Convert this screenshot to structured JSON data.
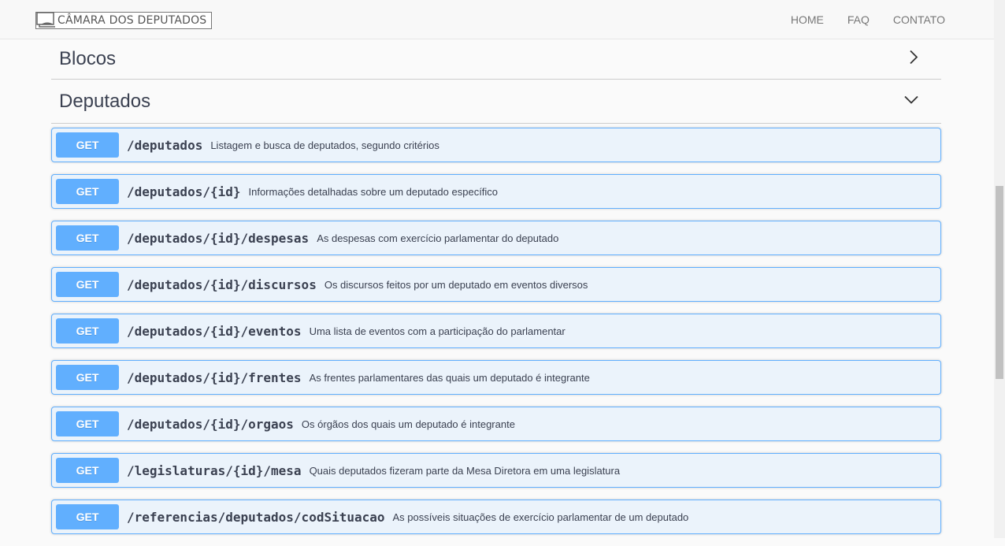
{
  "brand": {
    "text": "CÂMARA DOS DEPUTADOS"
  },
  "nav": {
    "home": "HOME",
    "faq": "FAQ",
    "contato": "CONTATO"
  },
  "sections": {
    "blocos": {
      "title": "Blocos",
      "expanded": false
    },
    "deputados": {
      "title": "Deputados",
      "expanded": true
    }
  },
  "operations": [
    {
      "method": "GET",
      "path": "/deputados",
      "description": "Listagem e busca de deputados, segundo critérios"
    },
    {
      "method": "GET",
      "path": "/deputados/{id}",
      "description": "Informações detalhadas sobre um deputado específico"
    },
    {
      "method": "GET",
      "path": "/deputados/{id}/despesas",
      "description": "As despesas com exercício parlamentar do deputado"
    },
    {
      "method": "GET",
      "path": "/deputados/{id}/discursos",
      "description": "Os discursos feitos por um deputado em eventos diversos"
    },
    {
      "method": "GET",
      "path": "/deputados/{id}/eventos",
      "description": "Uma lista de eventos com a participação do parlamentar"
    },
    {
      "method": "GET",
      "path": "/deputados/{id}/frentes",
      "description": "As frentes parlamentares das quais um deputado é integrante"
    },
    {
      "method": "GET",
      "path": "/deputados/{id}/orgaos",
      "description": "Os órgãos dos quais um deputado é integrante"
    },
    {
      "method": "GET",
      "path": "/legislaturas/{id}/mesa",
      "description": "Quais deputados fizeram parte da Mesa Diretora em uma legislatura"
    },
    {
      "method": "GET",
      "path": "/referencias/deputados/codSituacao",
      "description": "As possíveis situações de exercício parlamentar de um deputado"
    }
  ],
  "colors": {
    "get_accent": "#61affe",
    "get_background": "#ebf3fb",
    "text": "#3b4151"
  }
}
